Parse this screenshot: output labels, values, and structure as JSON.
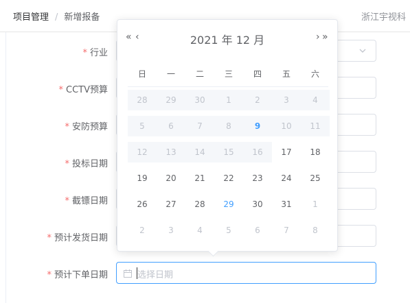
{
  "breadcrumb": {
    "root": "项目管理",
    "separator": "/",
    "current": "新增报备"
  },
  "header": {
    "company": "浙江宇视科"
  },
  "form": {
    "fields": [
      {
        "label": "行业",
        "required_mark": "*"
      },
      {
        "label": "CCTV预算",
        "required_mark": "*"
      },
      {
        "label": "安防预算",
        "required_mark": "*"
      },
      {
        "label": "投标日期",
        "required_mark": "*"
      },
      {
        "label": "截镖日期",
        "required_mark": "*"
      },
      {
        "label": "预计发货日期",
        "required_mark": "*"
      },
      {
        "label": "预计下单日期",
        "required_mark": "*"
      }
    ],
    "date_input_placeholder": "选择日期"
  },
  "datepicker": {
    "title": "2021 年  12 月",
    "nav": {
      "prev_year": "«",
      "prev_month": "‹",
      "next_month": "›",
      "next_year": "»"
    },
    "weekdays": [
      "日",
      "一",
      "二",
      "三",
      "四",
      "五",
      "六"
    ],
    "weeks": [
      [
        "28",
        "29",
        "30",
        "1",
        "2",
        "3",
        "4"
      ],
      [
        "5",
        "6",
        "7",
        "8",
        "9",
        "10",
        "11"
      ],
      [
        "12",
        "13",
        "14",
        "15",
        "16",
        "17",
        "18"
      ],
      [
        "19",
        "20",
        "21",
        "22",
        "23",
        "24",
        "25"
      ],
      [
        "26",
        "27",
        "28",
        "29",
        "30",
        "31",
        "1"
      ],
      [
        "2",
        "3",
        "4",
        "5",
        "6",
        "7",
        "8"
      ]
    ],
    "today": "9",
    "colors": {
      "accent": "#409eff",
      "muted": "#c0c4cc",
      "disabled_bg": "#f5f7fa"
    }
  }
}
